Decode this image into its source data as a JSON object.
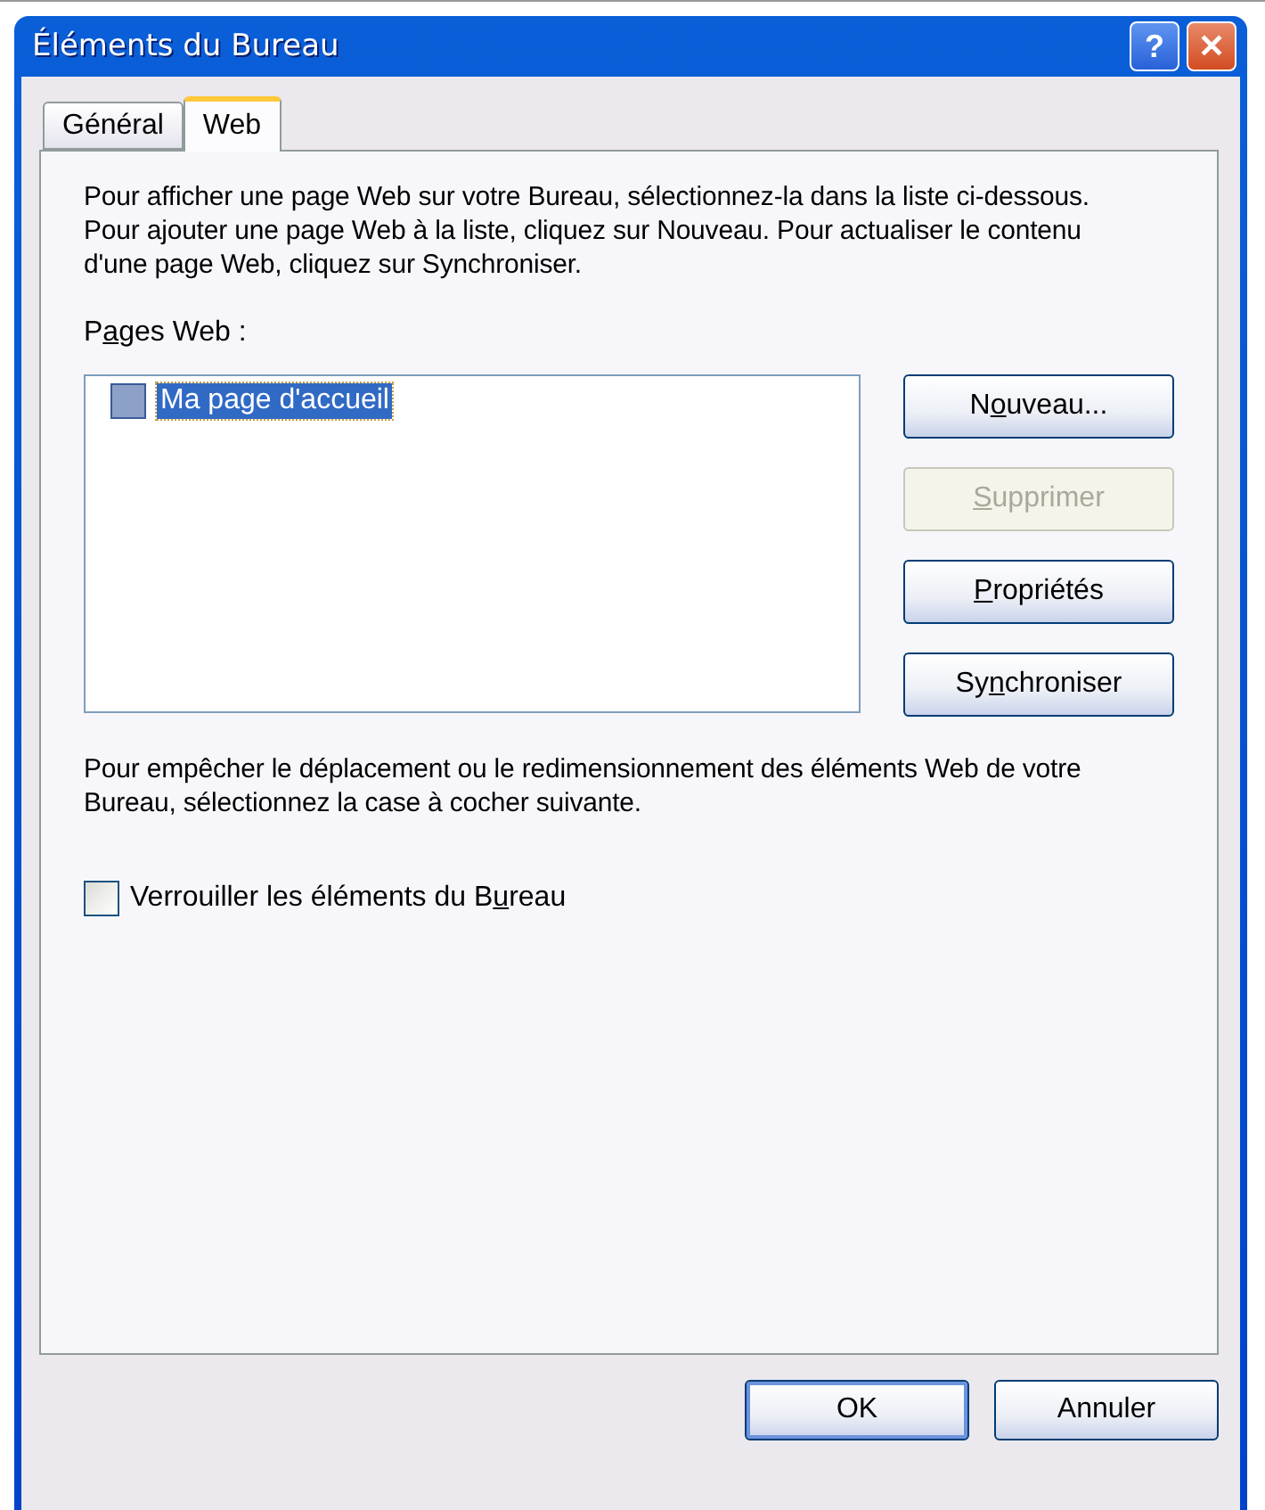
{
  "window": {
    "title": "Éléments du Bureau",
    "title_buttons": [
      {
        "kind": "help",
        "label": "?"
      },
      {
        "kind": "close",
        "label": "✕"
      }
    ]
  },
  "tabs": [
    {
      "label": "Général",
      "selected": false
    },
    {
      "label": "Web",
      "selected": true
    }
  ],
  "intro": "Pour afficher une page Web sur votre Bureau, sélectionnez-la dans la liste ci-dessous. Pour ajouter une page Web à la liste, cliquez sur Nouveau. Pour actualiser le contenu d'une page Web, cliquez sur Synchroniser.",
  "pages_label": {
    "pre": "P",
    "key": "a",
    "post": "ges Web :"
  },
  "pages": [
    {
      "label": "Ma page d'accueil",
      "checked": false,
      "selected": true
    }
  ],
  "side_buttons": [
    {
      "pre": "N",
      "key": "o",
      "post": "uveau...",
      "disabled": false
    },
    {
      "key": "S",
      "post": "upprimer",
      "disabled": true
    },
    {
      "key": "P",
      "post": "ropriétés",
      "disabled": false
    },
    {
      "pre": "Sy",
      "key": "n",
      "post": "chroniser",
      "disabled": false
    }
  ],
  "lock_text": "Pour empêcher le déplacement ou le redimensionnement des éléments Web de votre Bureau, sélectionnez la case à cocher suivante.",
  "lock_checkbox": {
    "pre": "Verrouiller les éléments du B",
    "key": "u",
    "post": "reau",
    "checked": false
  },
  "footer_buttons": [
    {
      "label": "OK",
      "default": true
    },
    {
      "label": "Annuler",
      "default": false
    }
  ]
}
